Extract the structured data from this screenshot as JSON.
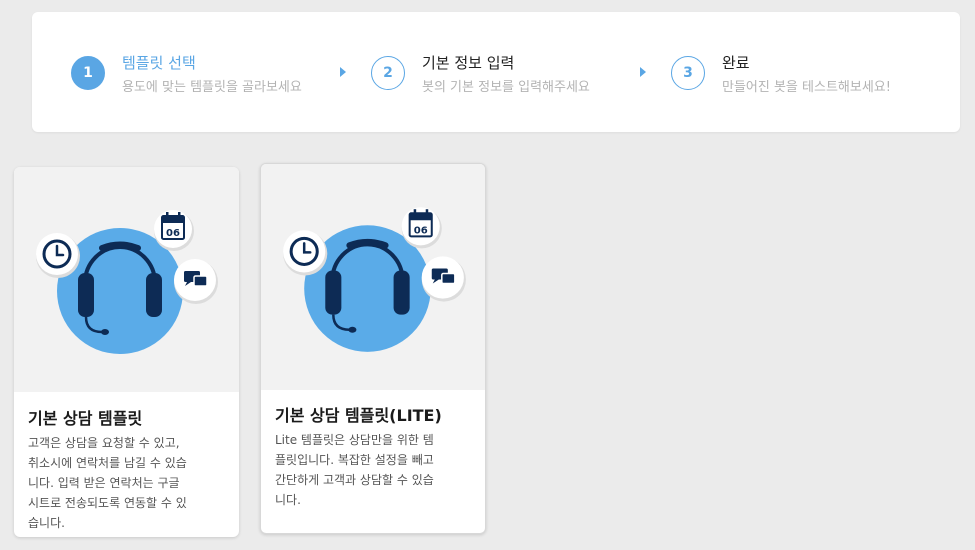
{
  "stepper": {
    "steps": [
      {
        "number": "1",
        "title": "템플릿 선택",
        "subtitle": "용도에 맞는 템플릿을 골라보세요"
      },
      {
        "number": "2",
        "title": "기본 정보 입력",
        "subtitle": "봇의 기본 정보를 입력해주세요"
      },
      {
        "number": "3",
        "title": "완료",
        "subtitle": "만들어진 봇을 테스트해보세요!"
      }
    ]
  },
  "cards": [
    {
      "title": "기본 상담 템플릿",
      "desc_lines": [
        "고객은 상담을 요청할 수 있고,",
        "취소시에 연락처를 남길 수 있습",
        "니다. 입력 받은 연락처는 구글",
        "시트로 전송되도록 연동할 수 있",
        "습니다."
      ],
      "calendar_day": "06"
    },
    {
      "title": "기본 상담 템플릿(LITE)",
      "desc_lines": [
        "Lite 템플릿은 상담만을 위한 템",
        "플릿입니다. 복잡한 설정을 빼고",
        "간단하게 고객과 상담할 수 있습",
        "니다."
      ],
      "calendar_day": "06"
    }
  ],
  "icons": {
    "card_illustration": [
      "clock-icon",
      "headset-icon",
      "calendar-icon",
      "chat-icon"
    ]
  },
  "colors": {
    "accent": "#5aa6e4",
    "circle": "#5aabe8",
    "navy": "#0d2b55",
    "background": "#ebebeb"
  }
}
